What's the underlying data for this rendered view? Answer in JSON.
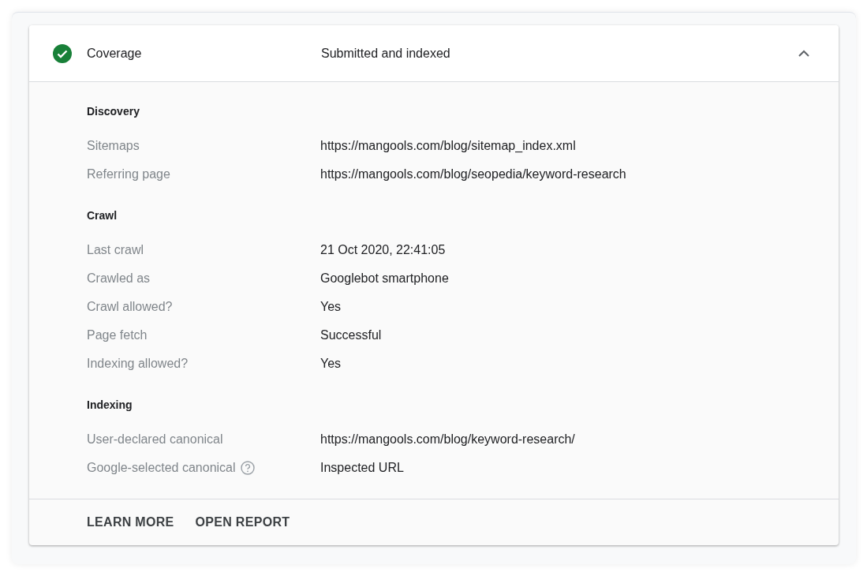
{
  "header": {
    "title": "Coverage",
    "kind": "valid",
    "value": "Submitted and indexed",
    "expanded": true
  },
  "sections": [
    {
      "title": "Discovery",
      "rows": [
        {
          "label": "Sitemaps",
          "value": "https://mangools.com/blog/sitemap_index.xml"
        },
        {
          "label": "Referring page",
          "value": "https://mangools.com/blog/seopedia/keyword-research"
        }
      ]
    },
    {
      "title": "Crawl",
      "rows": [
        {
          "label": "Last crawl",
          "value": "21 Oct 2020, 22:41:05"
        },
        {
          "label": "Crawled as",
          "value": "Googlebot smartphone"
        },
        {
          "label": "Crawl allowed?",
          "value": "Yes"
        },
        {
          "label": "Page fetch",
          "value": "Successful"
        },
        {
          "label": "Indexing allowed?",
          "value": "Yes"
        }
      ]
    },
    {
      "title": "Indexing",
      "rows": [
        {
          "label": "User-declared canonical",
          "value": "https://mangools.com/blog/keyword-research/"
        },
        {
          "label": "Google-selected canonical",
          "value": "Inspected URL",
          "help": true
        }
      ]
    }
  ],
  "actions": [
    "LEARN MORE",
    "OPEN REPORT"
  ]
}
